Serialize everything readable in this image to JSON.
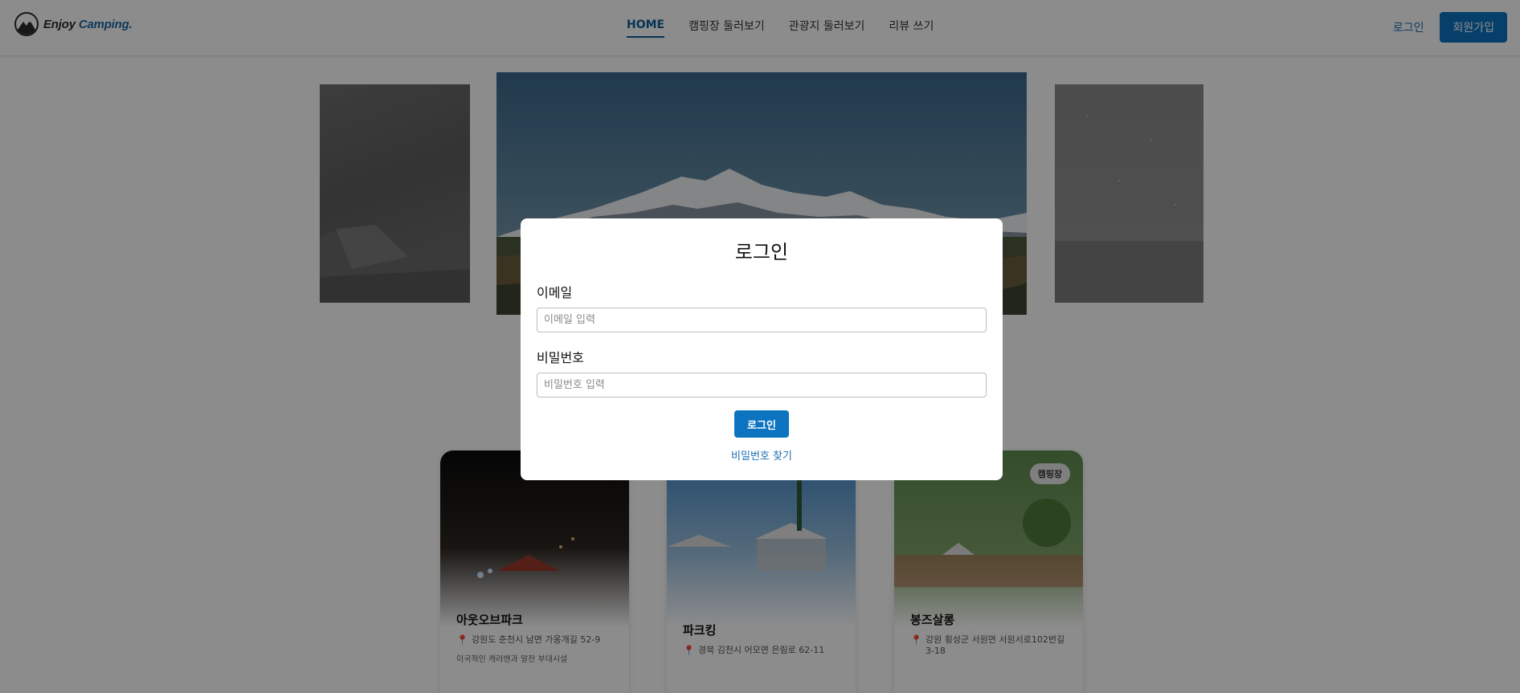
{
  "header": {
    "logo": {
      "brand_word": "Enjoy",
      "accent_word": "Camping."
    },
    "nav": [
      {
        "label": "HOME",
        "active": true
      },
      {
        "label": "캠핑장 둘러보기",
        "active": false
      },
      {
        "label": "관광지 둘러보기",
        "active": false
      },
      {
        "label": "리뷰 쓰기",
        "active": false
      }
    ],
    "login_label": "로그인",
    "signup_label": "회원가입"
  },
  "cards": [
    {
      "badge": "",
      "title": "아웃오브파크",
      "address": "강원도 춘천시 남면 가옹개길 52-9",
      "description": "이국적인 캐러밴과 알찬 부대시설"
    },
    {
      "badge": "",
      "title": "파크킹",
      "address": "경북 김천시 어모면 은림로 62-11",
      "description": ""
    },
    {
      "badge": "캠핑장",
      "title": "봉즈살롱",
      "address": "강원 횡성군 서원면 서원서로102번길 3-18",
      "description": ""
    }
  ],
  "modal": {
    "title": "로그인",
    "email_label": "이메일",
    "email_placeholder": "이메일 입력",
    "password_label": "비밀번호",
    "password_placeholder": "비밀번호 입력",
    "submit_label": "로그인",
    "find_password_label": "비밀번호 찾기"
  },
  "colors": {
    "primary": "#0b73bf",
    "link": "#1b6fb5",
    "nav_active": "#0d5f9c",
    "overlay": "rgba(0,0,0,0.45)"
  }
}
